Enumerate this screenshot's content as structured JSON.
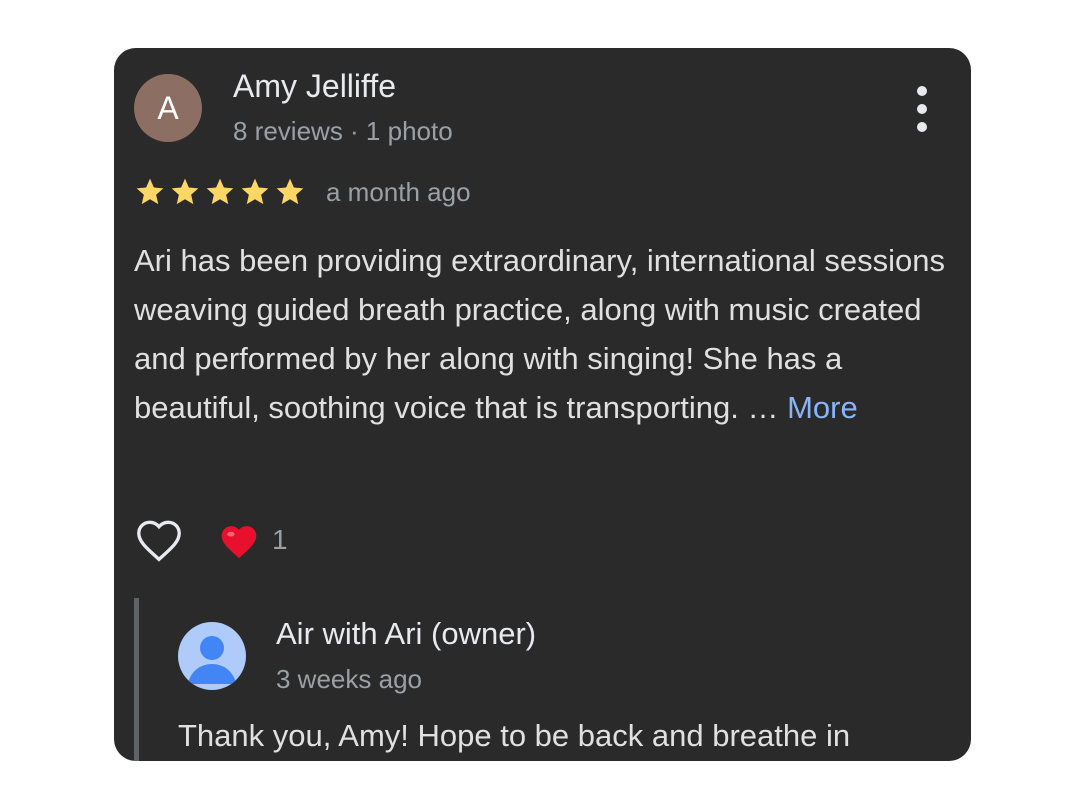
{
  "review": {
    "avatar_initial": "A",
    "avatar_color": "#8d6e63",
    "reviewer_name": "Amy Jelliffe",
    "reviewer_meta": "8 reviews · 1 photo",
    "menu_icon": "more-vert-icon",
    "rating": 5,
    "rating_max": 5,
    "star_color": "#fdd663",
    "timestamp": "a month ago",
    "text": "Ari has been providing extraordinary, international sessions weaving guided breath practice, along with music created and performed by her along with singing! She has a beautiful, soothing voice that is transporting. …",
    "more_label": "More",
    "reaction_count": "1"
  },
  "owner_reply": {
    "name": "Air with Ari (owner)",
    "timestamp": "3 weeks ago",
    "text": "Thank you, Amy! Hope to be back and breathe in"
  },
  "colors": {
    "card_background": "#2a2a2b",
    "link": "#8ab4f8",
    "reaction_heart": "#e8112d"
  }
}
